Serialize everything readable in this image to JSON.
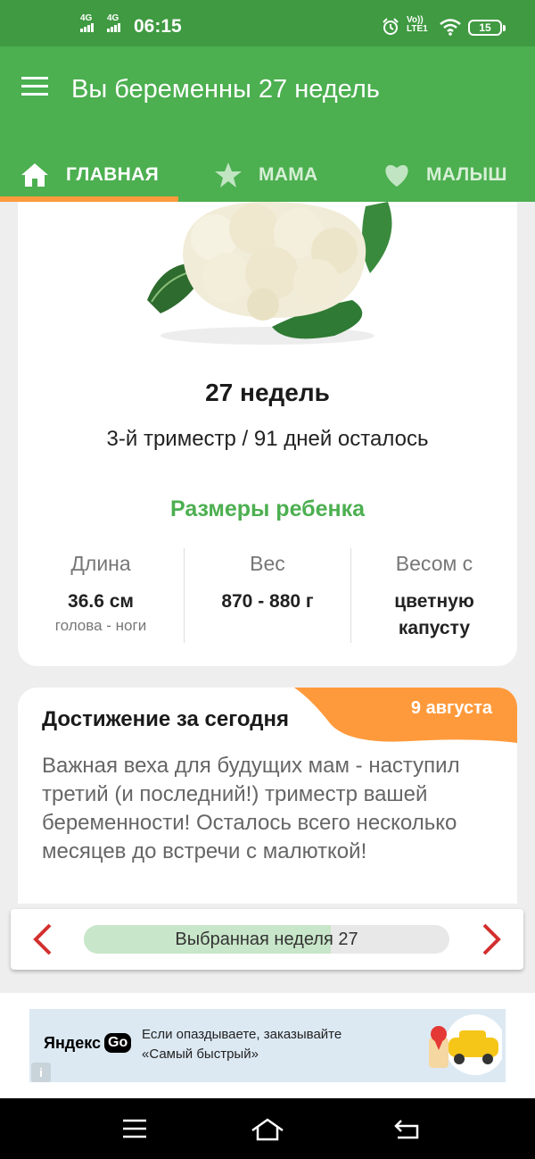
{
  "status_bar": {
    "sim1": "4G",
    "sim2": "4G",
    "time": "06:15",
    "volte_top": "Vo))",
    "volte_bottom": "LTE1",
    "battery": "15"
  },
  "app_bar": {
    "title": "Вы беременны 27 недель"
  },
  "tabs": [
    {
      "label": "ГЛАВНАЯ",
      "icon": "home-icon",
      "active": true
    },
    {
      "label": "МАМА",
      "icon": "star-icon",
      "active": false
    },
    {
      "label": "МАЛЫШ",
      "icon": "heart-icon",
      "active": false
    }
  ],
  "week_card": {
    "weeks_title": "27 недель",
    "trimester_text": "3-й триместр / 91 дней осталось",
    "sizes_title": "Размеры ребенка",
    "metrics": [
      {
        "label": "Длина",
        "value": "36.6 см",
        "sub": "голова - ноги"
      },
      {
        "label": "Вес",
        "value": "870 - 880 г",
        "sub": ""
      },
      {
        "label": "Весом с",
        "value": "цветную капусту",
        "sub": ""
      }
    ]
  },
  "achievement": {
    "date": "9 августа",
    "title": "Достижение за сегодня",
    "text": "Важная веха для будущих мам - наступил третий (и последний!) триместр вашей беременности! Осталось всего несколько месяцев до встречи с малюткой!"
  },
  "week_selector": {
    "label": "Выбранная неделя 27",
    "progress_fraction": 0.675
  },
  "ad": {
    "brand": "Яндекс",
    "brand_suffix": "Go",
    "line1": "Если опаздываете, заказывайте",
    "line2": "«Самый быстрый»",
    "info": "i"
  },
  "colors": {
    "primary": "#4caf50",
    "status_bar": "#3f9a41",
    "accent": "#ff9a3c",
    "arrow": "#d32f2f"
  }
}
